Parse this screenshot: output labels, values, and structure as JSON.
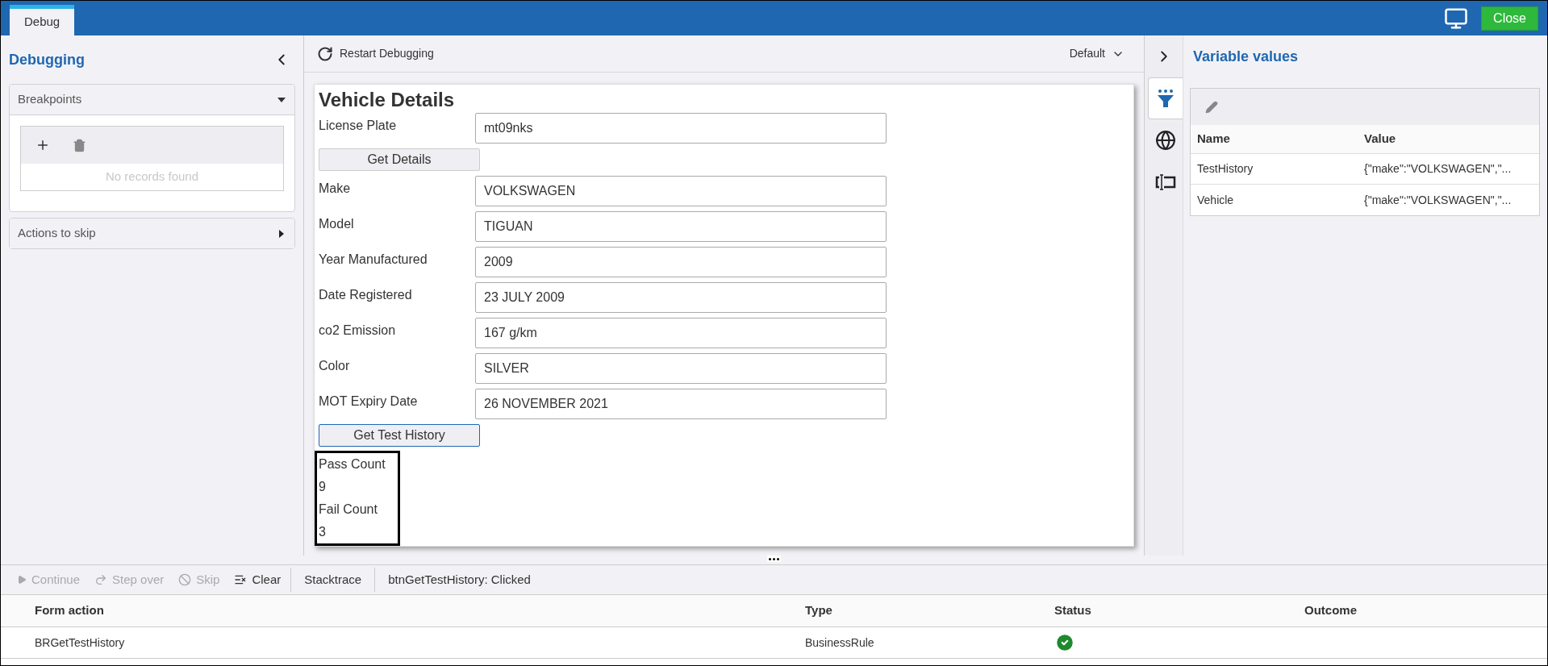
{
  "top_bar": {
    "tabs": [
      {
        "label": "Debug",
        "selected": true
      }
    ],
    "close_button": "Close"
  },
  "left_panel": {
    "title": "Debugging",
    "sections": [
      {
        "title": "Breakpoints",
        "expanded": true,
        "empty_message": "No records found"
      },
      {
        "title": "Actions to skip",
        "expanded": false
      }
    ]
  },
  "toolbar": {
    "restart": "Restart Debugging",
    "view": "Default"
  },
  "form": {
    "title": "Vehicle Details",
    "items": [
      {
        "kind": "field",
        "label": "License Plate",
        "value": "mt09nks"
      },
      {
        "kind": "button",
        "label": "Get Details",
        "focused": false
      },
      {
        "kind": "field",
        "label": "Make",
        "value": "VOLKSWAGEN"
      },
      {
        "kind": "field",
        "label": "Model",
        "value": "TIGUAN"
      },
      {
        "kind": "field",
        "label": "Year Manufactured",
        "value": "2009"
      },
      {
        "kind": "field",
        "label": "Date Registered",
        "value": "23 JULY 2009"
      },
      {
        "kind": "field",
        "label": "co2 Emission",
        "value": "167 g/km"
      },
      {
        "kind": "field",
        "label": "Color",
        "value": "SILVER"
      },
      {
        "kind": "field",
        "label": "MOT Expiry Date",
        "value": "26 NOVEMBER 2021"
      },
      {
        "kind": "button",
        "label": "Get Test History",
        "focused": true
      },
      {
        "kind": "output",
        "lines": [
          "Pass Count",
          "9",
          "Fail Count",
          "3"
        ]
      }
    ]
  },
  "right_panel": {
    "title": "Variable values",
    "side_tabs": [
      {
        "kind": "filter",
        "selected": true
      },
      {
        "kind": "globe",
        "selected": false
      },
      {
        "kind": "variable",
        "selected": false
      }
    ],
    "table": {
      "columns": [
        "Name",
        "Value"
      ],
      "rows": [
        [
          "TestHistory",
          "{\"make\":\"VOLKSWAGEN\",\"..."
        ],
        [
          "Vehicle",
          "{\"make\":\"VOLKSWAGEN\",\"..."
        ]
      ]
    }
  },
  "bottom": {
    "actions": [
      {
        "kind": "continue",
        "label": "Continue",
        "disabled": true
      },
      {
        "kind": "step_over",
        "label": "Step over",
        "disabled": true
      },
      {
        "kind": "skip",
        "label": "Skip",
        "disabled": true
      },
      {
        "kind": "clear",
        "label": "Clear",
        "disabled": false
      }
    ],
    "stacktrace": "Stacktrace",
    "event": "btnGetTestHistory: Clicked",
    "table": {
      "columns": [
        "Form action",
        "Type",
        "Status",
        "Outcome"
      ],
      "rows": [
        {
          "form_action": "BRGetTestHistory",
          "type": "BusinessRule",
          "status_ok": true
        }
      ]
    }
  }
}
